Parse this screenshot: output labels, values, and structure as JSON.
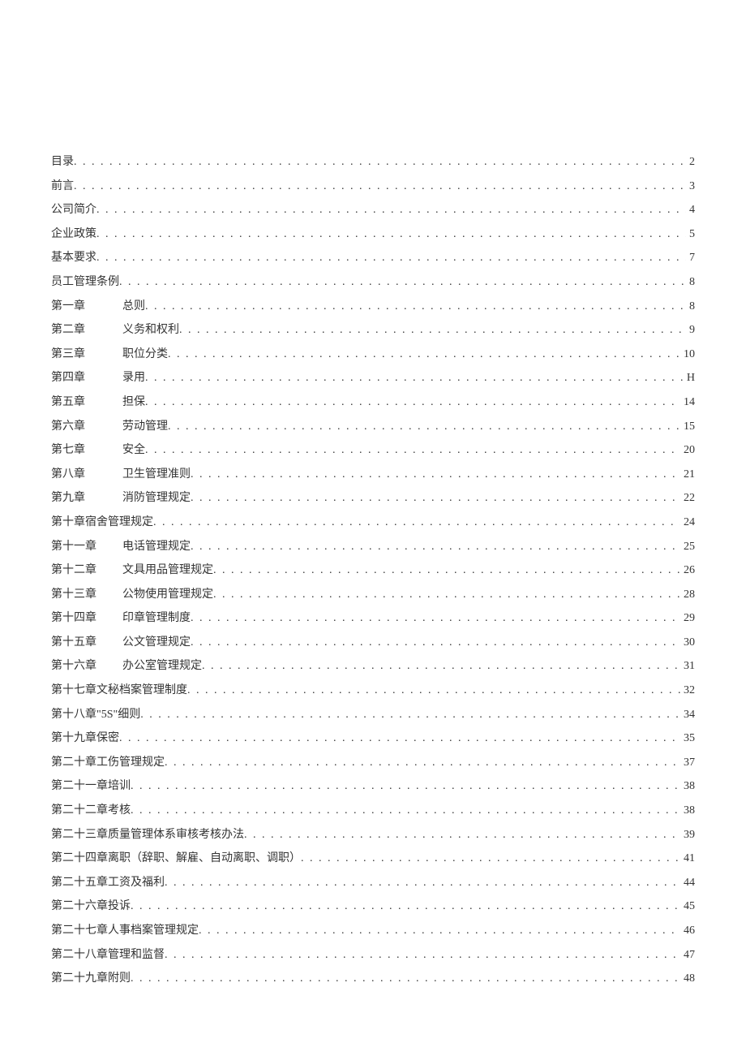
{
  "toc": [
    {
      "chapter": "",
      "title": "目录",
      "page": "2",
      "indented": false
    },
    {
      "chapter": "",
      "title": "前言",
      "page": "3",
      "indented": false
    },
    {
      "chapter": "",
      "title": "公司简介",
      "page": "4",
      "indented": false
    },
    {
      "chapter": "",
      "title": "企业政策",
      "page": "5",
      "indented": false
    },
    {
      "chapter": "",
      "title": "基本要求",
      "page": "7",
      "indented": false
    },
    {
      "chapter": "",
      "title": "员工管理条例",
      "page": "8",
      "indented": false
    },
    {
      "chapter": "第一章",
      "title": "总则",
      "page": "8",
      "indented": true
    },
    {
      "chapter": "第二章",
      "title": "义务和权利",
      "page": "9",
      "indented": true
    },
    {
      "chapter": "第三章",
      "title": "职位分类",
      "page": "10",
      "indented": true
    },
    {
      "chapter": "第四章",
      "title": "录用",
      "page": "H",
      "indented": true
    },
    {
      "chapter": "第五章",
      "title": "担保",
      "page": "14",
      "indented": true
    },
    {
      "chapter": "第六章",
      "title": "劳动管理",
      "page": "15",
      "indented": true
    },
    {
      "chapter": "第七章",
      "title": "安全",
      "page": "20",
      "indented": true
    },
    {
      "chapter": "第八章",
      "title": "卫生管理准则",
      "page": "21",
      "indented": true
    },
    {
      "chapter": "第九章",
      "title": "消防管理规定",
      "page": "22",
      "indented": true
    },
    {
      "chapter": "",
      "title": "第十章宿舍管理规定",
      "page": "24",
      "indented": false
    },
    {
      "chapter": "第十一章",
      "title": "电话管理规定",
      "page": "25",
      "indented": true
    },
    {
      "chapter": "第十二章",
      "title": "文具用品管理规定",
      "page": "26",
      "indented": true
    },
    {
      "chapter": "第十三章",
      "title": "公物使用管理规定",
      "page": "28",
      "indented": true
    },
    {
      "chapter": "第十四章",
      "title": "印章管理制度",
      "page": "29",
      "indented": true
    },
    {
      "chapter": "第十五章",
      "title": "公文管理规定",
      "page": "30",
      "indented": true
    },
    {
      "chapter": "第十六章",
      "title": "办公室管理规定",
      "page": "31",
      "indented": true
    },
    {
      "chapter": "",
      "title": "第十七章文秘档案管理制度",
      "page": "32",
      "indented": false
    },
    {
      "chapter": "",
      "title": "第十八章\"5S\"细则",
      "page": "34",
      "indented": false
    },
    {
      "chapter": "",
      "title": "第十九章保密",
      "page": "35",
      "indented": false
    },
    {
      "chapter": "",
      "title": "第二十章工伤管理规定",
      "page": "37",
      "indented": false
    },
    {
      "chapter": "",
      "title": "第二十一章培训",
      "page": "38",
      "indented": false
    },
    {
      "chapter": "",
      "title": "第二十二章考核",
      "page": "38",
      "indented": false
    },
    {
      "chapter": "",
      "title": "第二十三章质量管理体系审核考核办法",
      "page": "39",
      "indented": false
    },
    {
      "chapter": "",
      "title": "第二十四章离职（辞职、解雇、自动离职、调职）",
      "page": "41",
      "indented": false
    },
    {
      "chapter": "",
      "title": "第二十五章工资及福利",
      "page": "44",
      "indented": false
    },
    {
      "chapter": "",
      "title": "第二十六章投诉",
      "page": "45",
      "indented": false
    },
    {
      "chapter": "",
      "title": "第二十七章人事档案管理规定",
      "page": "46",
      "indented": false
    },
    {
      "chapter": "",
      "title": "第二十八章管理和监督",
      "page": "47",
      "indented": false
    },
    {
      "chapter": "",
      "title": "第二十九章附则",
      "page": "48",
      "indented": false
    }
  ]
}
